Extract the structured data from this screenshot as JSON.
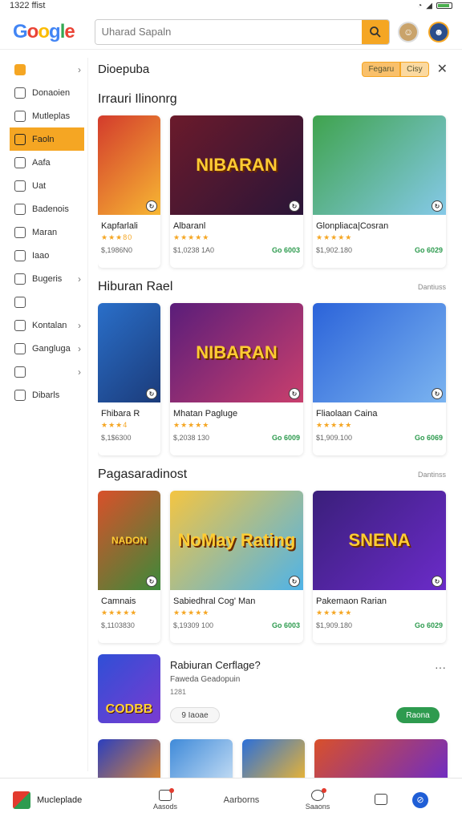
{
  "status_bar": {
    "time": "1322 ffist"
  },
  "header": {
    "logo_letters": [
      "G",
      "o",
      "o",
      "g",
      "l",
      "e"
    ],
    "search_placeholder": "Uharad Sapaln",
    "search_icon": "search-icon"
  },
  "sidebar": {
    "items": [
      {
        "label": "",
        "icon": "home-icon",
        "chevron": true
      },
      {
        "label": "Donaoien",
        "icon": "document-icon",
        "chevron": false
      },
      {
        "label": "Mutleplas",
        "icon": "grid-icon",
        "chevron": false
      },
      {
        "label": "Faoln",
        "icon": "calendar-icon",
        "chevron": false,
        "active": true
      },
      {
        "label": "Aafa",
        "icon": "file-icon",
        "chevron": false
      },
      {
        "label": "Uat",
        "icon": "clock-icon",
        "chevron": false
      },
      {
        "label": "Badenois",
        "icon": "folder-icon",
        "chevron": false
      },
      {
        "label": "Maran",
        "icon": "image-icon",
        "chevron": false
      },
      {
        "label": "Iaao",
        "icon": "tag-icon",
        "chevron": false
      },
      {
        "label": "Bugeris",
        "icon": "pen-icon",
        "chevron": true
      },
      {
        "label": "",
        "icon": "inbox-icon",
        "chevron": false
      },
      {
        "label": "Kontalan",
        "icon": "chart-icon",
        "chevron": true
      },
      {
        "label": "Gangluga",
        "icon": "chat-icon",
        "chevron": true
      },
      {
        "label": "",
        "icon": "clipboard-icon",
        "chevron": true
      },
      {
        "label": "Dibarls",
        "icon": "list-icon",
        "chevron": false
      }
    ]
  },
  "main": {
    "header_title": "Dioepuba",
    "pills": [
      "Fegaru",
      "Cisy"
    ],
    "sections": [
      {
        "title": "Irrauri Ilinonrg",
        "more": "",
        "cards": [
          {
            "name": "Kapfarlali",
            "stars": "★★★80",
            "meta": "$,1986N0",
            "price": "",
            "size": "sm",
            "colors": [
              "#d33b2c",
              "#f7b733"
            ],
            "caption": ""
          },
          {
            "name": "Albaranl",
            "stars": "★★★★★",
            "meta": "$1,0238 1A0",
            "price": "Go 6003",
            "size": "lg",
            "colors": [
              "#6b1a2b",
              "#2a1538"
            ],
            "caption": "NIBARAN"
          },
          {
            "name": "Glonpliaca|Cosran",
            "stars": "★★★★★",
            "meta": "$1,902.180",
            "price": "Go 6029",
            "size": "lg",
            "colors": [
              "#3fa34d",
              "#85c9e8"
            ],
            "caption": ""
          }
        ]
      },
      {
        "title": "Hiburan Rael",
        "more": "Dantiuss",
        "cards": [
          {
            "name": "Fhibara R",
            "stars": "★★★4",
            "meta": "$,1$6300",
            "price": "",
            "size": "sm",
            "colors": [
              "#2a6fc9",
              "#1b3b7a"
            ],
            "caption": ""
          },
          {
            "name": "Mhatan Pagluge",
            "stars": "★★★★★",
            "meta": "$,2038 130",
            "price": "Go 6009",
            "size": "lg",
            "colors": [
              "#5a1d7a",
              "#c93f6d"
            ],
            "caption": "NIBARAN"
          },
          {
            "name": "Fliaolaan Caina",
            "stars": "★★★★★",
            "meta": "$1,909.100",
            "price": "Go 6069",
            "size": "lg",
            "colors": [
              "#2b63d9",
              "#7bb4f0"
            ],
            "caption": ""
          }
        ]
      },
      {
        "title": "Pagasaradinost",
        "more": "Dantinss",
        "cards": [
          {
            "name": "Camnais",
            "stars": "★★★★★",
            "meta": "$,1103830",
            "price": "",
            "size": "sm",
            "colors": [
              "#d9502a",
              "#3c8a3a"
            ],
            "caption": "NADON"
          },
          {
            "name": "Sabiedhral Cog' Man",
            "stars": "★★★★★",
            "meta": "$,19309 100",
            "price": "Go 6003",
            "size": "lg",
            "colors": [
              "#f4c542",
              "#4fb3e8"
            ],
            "caption": "NoMay Rating"
          },
          {
            "name": "Pakemaon Rarian",
            "stars": "★★★★★",
            "meta": "$1,909.180",
            "price": "Go 6029",
            "size": "lg",
            "colors": [
              "#3a1f7a",
              "#6b2bc9"
            ],
            "caption": "SNENA"
          }
        ]
      }
    ],
    "feature": {
      "thumb_text": "CODBB",
      "title": "Rabiuran Cerflage?",
      "subtitle": "Faweda Geadopuin",
      "price": "1281",
      "secondary_label": "9 Iaoae",
      "primary_label": "Raona"
    },
    "bottom_strip_colors": [
      [
        "#2b3fbf",
        "#e88d2a"
      ],
      [
        "#3f8ad9",
        "#c9e0f5"
      ],
      [
        "#2b6fd9",
        "#f5b82a"
      ],
      [
        "#d9502a",
        "#6b2bc9"
      ]
    ]
  },
  "bottom_nav": {
    "brand": "Mucleplade",
    "items": [
      {
        "label": "Aasods",
        "icon": "shop-icon",
        "dot": true
      },
      {
        "label": "Aarborns",
        "icon": "",
        "dot": false
      },
      {
        "label": "Saaons",
        "icon": "chat-bubble-icon",
        "dot": true
      },
      {
        "label": "",
        "icon": "music-icon",
        "dot": false
      }
    ]
  },
  "colors": {
    "accent": "#f5a623",
    "price_green": "#2e9b4f",
    "nav_blue": "#1f5ed6"
  }
}
